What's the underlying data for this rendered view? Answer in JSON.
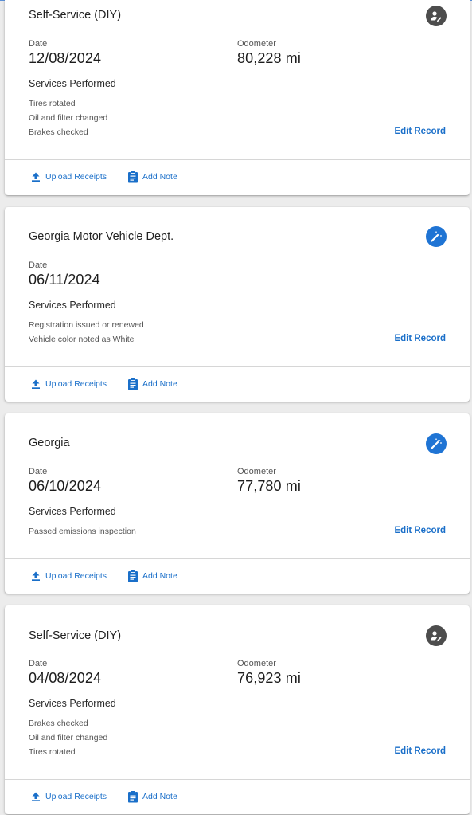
{
  "colors": {
    "accent": "#1a6fc9",
    "badge_gray": "#4d4d4d",
    "badge_blue": "#1f74d4"
  },
  "labels": {
    "date": "Date",
    "odometer": "Odometer",
    "services_performed": "Services Performed",
    "edit_record": "Edit Record",
    "upload_receipts": "Upload Receipts",
    "add_note": "Add Note"
  },
  "records": [
    {
      "provider": "Self-Service (DIY)",
      "badge_icon": "person-wrench-icon",
      "date": "12/08/2024",
      "odometer": "80,228 mi",
      "services": [
        "Tires rotated",
        "Oil and filter changed",
        "Brakes checked"
      ]
    },
    {
      "provider": "Georgia Motor Vehicle Dept.",
      "badge_icon": "magic-wand-icon",
      "date": "06/11/2024",
      "services": [
        "Registration issued or renewed",
        "Vehicle color noted as White"
      ]
    },
    {
      "provider": "Georgia",
      "badge_icon": "magic-wand-icon",
      "date": "06/10/2024",
      "odometer": "77,780 mi",
      "services": [
        "Passed emissions inspection"
      ]
    },
    {
      "provider": "Self-Service (DIY)",
      "badge_icon": "person-wrench-icon",
      "date": "04/08/2024",
      "odometer": "76,923 mi",
      "services": [
        "Brakes checked",
        "Oil and filter changed",
        "Tires rotated"
      ]
    }
  ]
}
